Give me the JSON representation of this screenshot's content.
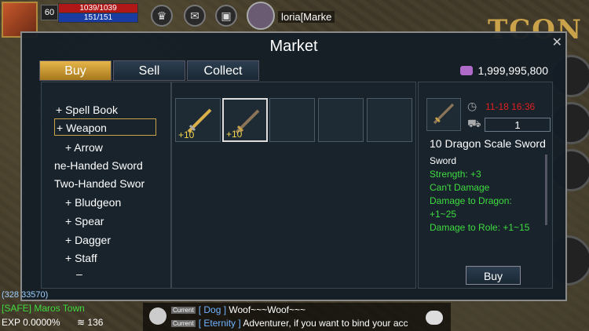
{
  "player": {
    "level": "60",
    "hp": "1039/1039",
    "mp": "151/151"
  },
  "target": {
    "name": "loria[Marke"
  },
  "hud_icons": [
    "crown-icon",
    "mail-icon",
    "gift-icon"
  ],
  "logo": "TCON",
  "market": {
    "title": "Market",
    "tabs": [
      "Buy",
      "Sell",
      "Collect"
    ],
    "active_tab": "Buy",
    "gold": "1,999,995,800",
    "categories": [
      {
        "label": "+  Spell Book"
      },
      {
        "label": "+  Weapon"
      },
      {
        "label": "+  Arrow"
      },
      {
        "label": "ne-Handed Sword"
      },
      {
        "label": "Two-Handed Swor"
      },
      {
        "label": "+  Bludgeon"
      },
      {
        "label": "+  Spear"
      },
      {
        "label": "+  Dagger"
      },
      {
        "label": "+  Staff"
      },
      {
        "label": "–"
      }
    ],
    "selected_category": "+  Weapon",
    "slots": [
      {
        "enchant": "+10",
        "icon": "sword-icon"
      },
      {
        "enchant": "+10",
        "icon": "sword-icon",
        "selected": true
      },
      {
        "enchant": ""
      },
      {
        "enchant": ""
      },
      {
        "enchant": ""
      }
    ],
    "detail": {
      "time": "11-18 16:36",
      "quantity": "1",
      "name": "10 Dragon Scale Sword",
      "stats": [
        {
          "text": "Sword",
          "color": "white"
        },
        {
          "text": "Strength: +3",
          "color": "green"
        },
        {
          "text": "Can't Damage",
          "color": "green"
        },
        {
          "text": "Damage to Dragon:",
          "color": "green"
        },
        {
          "text": "+1~25",
          "color": "green"
        },
        {
          "text": "Damage to Role: +1~15",
          "color": "green"
        }
      ],
      "buy_label": "Buy"
    }
  },
  "bottom": {
    "coords": "(328 33570)",
    "location": "[SAFE] Maros Town",
    "exp": "EXP 0.0000%",
    "ping": "136"
  },
  "chat": [
    {
      "channel": "Current",
      "name": "[ Dog ]",
      "text": "Woof~~~Woof~~~"
    },
    {
      "channel": "Current",
      "name": "[ Eternity ]",
      "text": "Adventurer, if you want to bind your acc"
    }
  ],
  "colors": {
    "accent": "#c9a24a",
    "green": "#3fdc3f",
    "red": "#e02020"
  }
}
